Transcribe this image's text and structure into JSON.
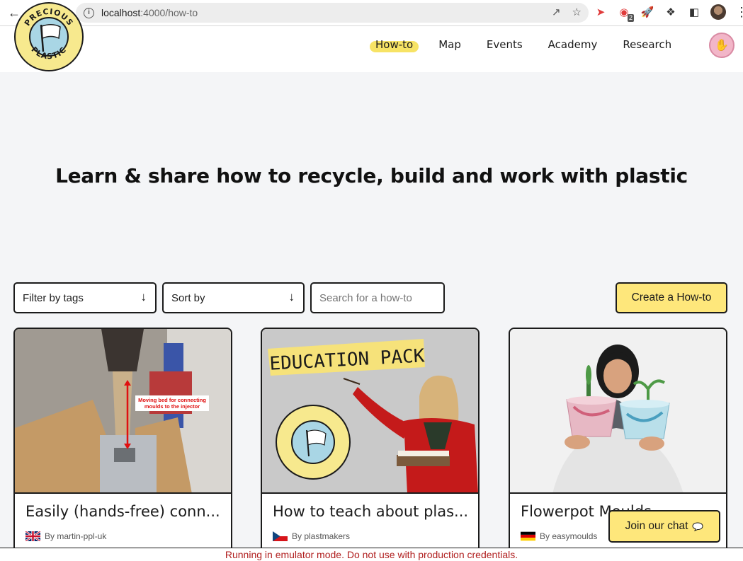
{
  "browser": {
    "url_host": "localhost",
    "url_path": ":4000/how-to",
    "extension_badge": "2"
  },
  "nav": {
    "items": [
      {
        "label": "How-to",
        "active": true
      },
      {
        "label": "Map"
      },
      {
        "label": "Events"
      },
      {
        "label": "Academy"
      },
      {
        "label": "Research"
      }
    ]
  },
  "logo": {
    "text_top": "PRECIOUS",
    "text_bottom": "PLASTIC"
  },
  "hero": {
    "title": "Learn & share how to recycle, build and work with plastic"
  },
  "controls": {
    "filter_label": "Filter by tags",
    "sort_label": "Sort by",
    "search_placeholder": "Search for a how-to",
    "create_label": "Create a How-to"
  },
  "cards": [
    {
      "title": "Easily (hands-free) conn...",
      "author": "By martin-ppl-uk",
      "flag": "uk",
      "image_caption": "Moving bed for connecting moulds to the injector"
    },
    {
      "title": "How to teach about plas...",
      "author": "By plastmakers",
      "flag": "cz",
      "image_caption": "EDUCATION PACK"
    },
    {
      "title": "Flowerpot Moulds",
      "author": "By easymoulds",
      "flag": "de"
    }
  ],
  "chat": {
    "label": "Join our chat"
  },
  "emulator_notice": "Running in emulator mode. Do not use with production credentials.",
  "colors": {
    "accent_yellow": "#fee77b",
    "highlight_yellow": "#f7e365",
    "border": "#1b1b1b",
    "background": "#f4f5f7",
    "warning_red": "#b01e1e"
  }
}
